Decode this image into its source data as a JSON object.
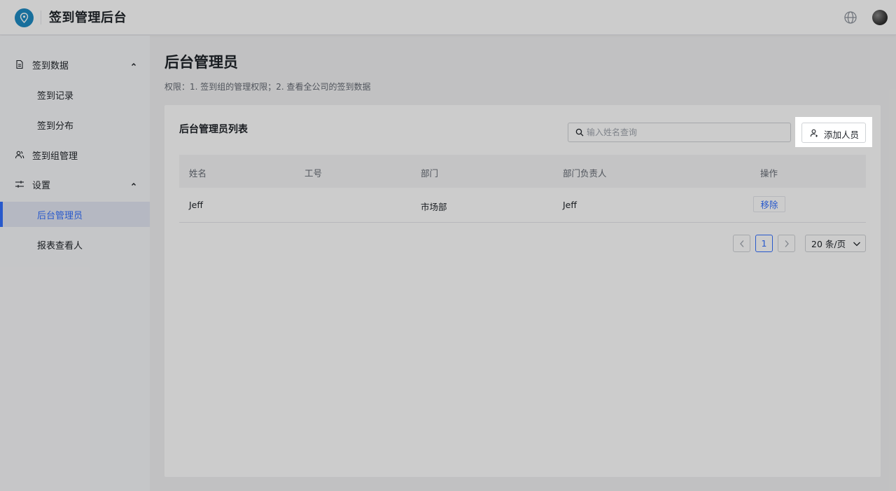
{
  "header": {
    "app_title": "签到管理后台",
    "logo_icon": "location-pin-icon",
    "language_icon": "globe-icon",
    "avatar_icon": "user-avatar"
  },
  "sidebar": {
    "items": [
      {
        "label": "签到数据",
        "icon": "document-icon",
        "expanded": true
      },
      {
        "label": "签到记录"
      },
      {
        "label": "签到分布"
      },
      {
        "label": "签到组管理",
        "icon": "users-icon"
      },
      {
        "label": "设置",
        "icon": "sliders-icon",
        "expanded": true
      },
      {
        "label": "后台管理员",
        "active": true
      },
      {
        "label": "报表查看人"
      }
    ]
  },
  "main": {
    "title": "后台管理员",
    "description": "权限：1. 签到组的管理权限；2. 查看全公司的签到数据",
    "card_title": "后台管理员列表",
    "search": {
      "placeholder": "输入姓名查询",
      "value": ""
    },
    "add_button": "添加人员",
    "table": {
      "columns": [
        "姓名",
        "工号",
        "部门",
        "部门负责人",
        "操作"
      ],
      "rows": [
        {
          "name": "Jeff",
          "employee_id": "",
          "department": "市场部",
          "dept_head": "Jeff",
          "action": "移除"
        }
      ]
    },
    "pagination": {
      "current_page": "1",
      "page_size": "20 条/页"
    }
  },
  "colors": {
    "accent": "#3370ff",
    "logo": "#1e8bc3"
  }
}
